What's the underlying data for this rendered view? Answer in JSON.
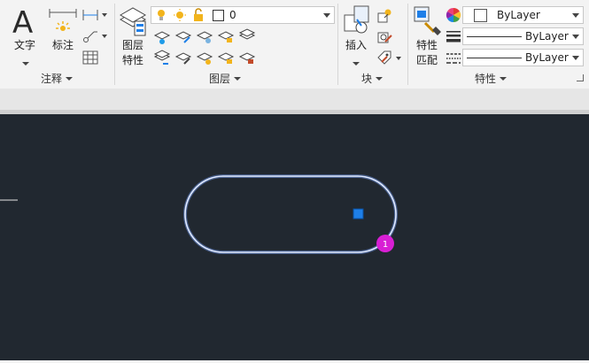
{
  "ribbon": {
    "annotation": {
      "text_label": "文字",
      "dim_label": "标注",
      "panel_title": "注释"
    },
    "layers": {
      "props_label_1": "图层",
      "props_label_2": "特性",
      "current_layer": "0",
      "panel_title": "图层"
    },
    "block": {
      "insert_label": "插入",
      "panel_title": "块"
    },
    "properties": {
      "match_label_1": "特性",
      "match_label_2": "匹配",
      "color_value": "ByLayer",
      "linetype_value": "ByLayer",
      "lineweight_value": "ByLayer",
      "panel_title": "特性"
    }
  },
  "drawing": {
    "badge_number": "1",
    "colors": {
      "background": "#212830",
      "shape_stroke": "#dfe9ff",
      "grip": "#1e7fe8",
      "badge": "#d81fd4"
    }
  }
}
